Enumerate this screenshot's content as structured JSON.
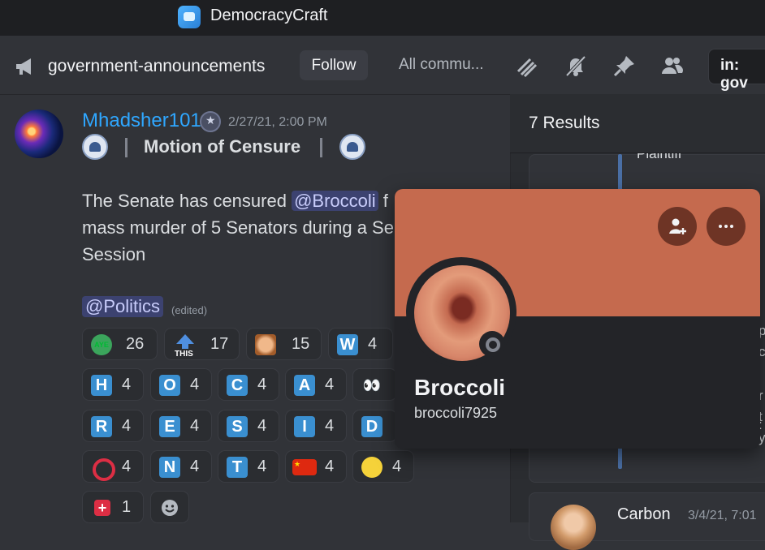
{
  "app": {
    "title": "DemocracyCraft"
  },
  "header": {
    "channel": "government-announcements",
    "follow_label": "Follow",
    "community_label": "All commu...",
    "search_text": "in: gov"
  },
  "message": {
    "author": "Mhadsher101",
    "timestamp": "2/27/21, 2:00 PM",
    "title": "Motion of Censure",
    "line1_pre": "The Senate has censured ",
    "line1_mention": "@Broccoli",
    "line1_post": " f",
    "line2": "mass murder of 5 Senators during a Se",
    "line3": "Session",
    "role_mention": "@Politics",
    "edited": "(edited)"
  },
  "reactions": [
    {
      "emoji": "AYE",
      "count": "26"
    },
    {
      "emoji": "THIS",
      "count": "17"
    },
    {
      "emoji": "face",
      "count": "15"
    },
    {
      "emoji": "W",
      "count": "4"
    },
    {
      "emoji": "H",
      "count": "4"
    },
    {
      "emoji": "O",
      "count": "4"
    },
    {
      "emoji": "C",
      "count": "4"
    },
    {
      "emoji": "A",
      "count": "4"
    },
    {
      "emoji": "eyes",
      "count": ""
    },
    {
      "emoji": "R",
      "count": "4"
    },
    {
      "emoji": "E",
      "count": "4"
    },
    {
      "emoji": "S",
      "count": "4"
    },
    {
      "emoji": "I",
      "count": "4"
    },
    {
      "emoji": "D",
      "count": ""
    },
    {
      "emoji": "ring",
      "count": "4"
    },
    {
      "emoji": "N",
      "count": "4"
    },
    {
      "emoji": "T",
      "count": "4"
    },
    {
      "emoji": "flag-cn",
      "count": "4"
    },
    {
      "emoji": "pacman",
      "count": "4"
    },
    {
      "emoji": "cross",
      "count": "1"
    }
  ],
  "results": {
    "title": "7 Results",
    "plaintiff": "Plaintiff",
    "fragments": [
      "p",
      "c",
      "r",
      "t",
      ":",
      "y"
    ],
    "next_author": "Carbon",
    "next_time": "3/4/21, 7:01"
  },
  "profile": {
    "display_name": "Broccoli",
    "username": "broccoli7925"
  },
  "colors": {
    "accent": "#c56a4e",
    "link": "#2fa7ff",
    "background": "#313338"
  }
}
